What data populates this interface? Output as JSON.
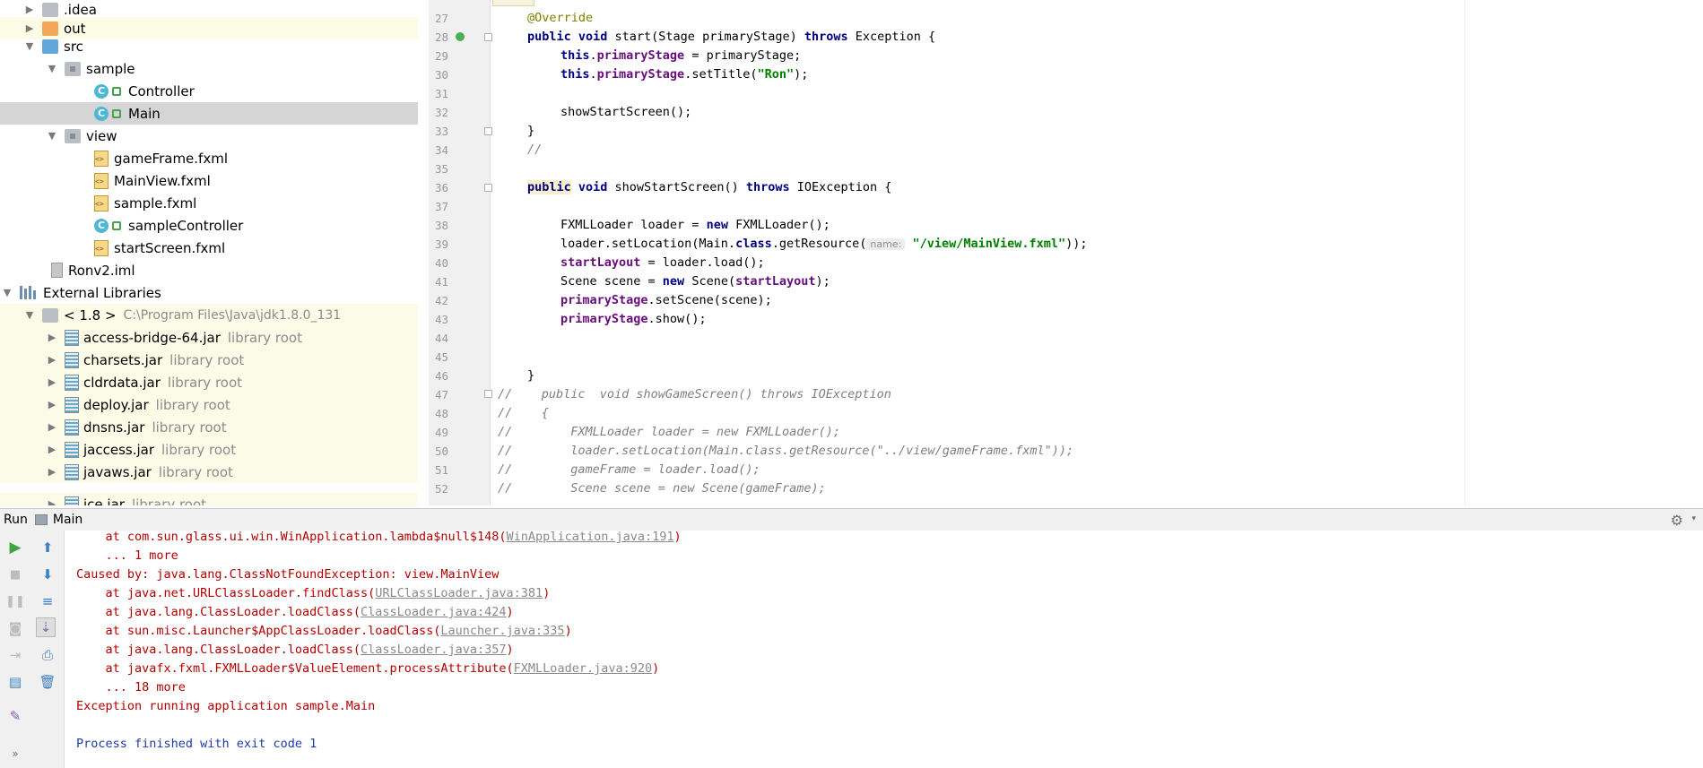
{
  "project_tree": {
    "items": [
      {
        "label": "idea",
        "prefix": ".",
        "arrow": "▶",
        "icon": "folder-icon"
      },
      {
        "label": "out",
        "arrow": "▶",
        "icon": "folder-orange-icon"
      },
      {
        "label": "src",
        "arrow": "▼",
        "icon": "folder-blue-icon"
      },
      {
        "label": "sample",
        "arrow": "▼",
        "icon": "package-icon"
      },
      {
        "label": "Controller",
        "icon": "class-icon"
      },
      {
        "label": "Main",
        "icon": "class-icon"
      },
      {
        "label": "view",
        "arrow": "▼",
        "icon": "package-icon"
      },
      {
        "label": "gameFrame.fxml",
        "icon": "fxml-file-icon"
      },
      {
        "label": "MainView.fxml",
        "icon": "fxml-file-icon"
      },
      {
        "label": "sample.fxml",
        "icon": "fxml-file-icon"
      },
      {
        "label": "sampleController",
        "icon": "class-icon"
      },
      {
        "label": "startScreen.fxml",
        "icon": "fxml-file-icon"
      },
      {
        "label": "Ronv2.iml",
        "icon": "iml-file-icon"
      },
      {
        "label": "External Libraries",
        "arrow": "▼",
        "icon": "libraries-icon"
      },
      {
        "label": "< 1.8 >",
        "detail": "C:\\Program Files\\Java\\jdk1.8.0_131",
        "arrow": "▼",
        "icon": "sdk-folder-icon"
      },
      {
        "label": "access-bridge-64.jar",
        "detail": "library root",
        "arrow": "▶",
        "icon": "jar-icon"
      },
      {
        "label": "charsets.jar",
        "detail": "library root",
        "arrow": "▶",
        "icon": "jar-icon"
      },
      {
        "label": "cldrdata.jar",
        "detail": "library root",
        "arrow": "▶",
        "icon": "jar-icon"
      },
      {
        "label": "deploy.jar",
        "detail": "library root",
        "arrow": "▶",
        "icon": "jar-icon"
      },
      {
        "label": "dnsns.jar",
        "detail": "library root",
        "arrow": "▶",
        "icon": "jar-icon"
      },
      {
        "label": "jaccess.jar",
        "detail": "library root",
        "arrow": "▶",
        "icon": "jar-icon"
      },
      {
        "label": "javaws.jar",
        "detail": "library root",
        "arrow": "▶",
        "icon": "jar-icon"
      },
      {
        "label": "jce.jar",
        "detail": "library root",
        "arrow": "▶",
        "icon": "jar-icon"
      }
    ]
  },
  "editor": {
    "line_numbers": [
      "27",
      "28",
      "29",
      "30",
      "31",
      "32",
      "33",
      "34",
      "35",
      "36",
      "37",
      "38",
      "39",
      "40",
      "41",
      "42",
      "43",
      "44",
      "45",
      "46",
      "47",
      "48",
      "49",
      "50",
      "51",
      "52"
    ],
    "code": {
      "l27": "@Override",
      "l28a": "public void",
      "l28b": " start(Stage primaryStage) ",
      "l28c": "throws",
      "l28d": " Exception {",
      "l29a": "this",
      "l29b": ".",
      "l29c": "primaryStage",
      "l29d": " = primaryStage;",
      "l30a": "this",
      "l30b": ".",
      "l30c": "primaryStage",
      "l30d": ".setTitle(",
      "l30e": "\"Ron\"",
      "l30f": ");",
      "l32": "showStartScreen();",
      "l33": "}",
      "l34": "//",
      "l36a": "public",
      "l36b": " void",
      "l36c": " showStartScreen() ",
      "l36d": "throws",
      "l36e": " IOException {",
      "l38a": "FXMLLoader loader = ",
      "l38b": "new",
      "l38c": " FXMLLoader();",
      "l39a": "loader.setLocation(Main.",
      "l39b": "class",
      "l39c": ".getResource(",
      "l39hint": "name:",
      "l39d": "\"/view/MainView.fxml\"",
      "l39e": "));",
      "l40a": "startLayout",
      "l40b": " = loader.load();",
      "l41a": "Scene scene = ",
      "l41b": "new",
      "l41c": " Scene(",
      "l41d": "startLayout",
      "l41e": ");",
      "l42a": "primaryStage",
      "l42b": ".setScene(scene);",
      "l43a": "primaryStage",
      "l43b": ".show();",
      "l46": "}",
      "l47": "//    public  void showGameScreen() throws IOException",
      "l48": "//    {",
      "l49": "//        FXMLLoader loader = new FXMLLoader();",
      "l50": "//        loader.setLocation(Main.class.getResource(\"../view/gameFrame.fxml\"));",
      "l51": "//        gameFrame = loader.load();",
      "l52": "//        Scene scene = new Scene(gameFrame);"
    }
  },
  "run_panel": {
    "title": "Run",
    "config": "Main",
    "console": [
      {
        "pre": "    at com.sun.glass.ui.win.WinApplication.lambda$null$148(",
        "link": "WinApplication.java:191",
        "post": ")"
      },
      {
        "pre": "    ... 1 more"
      },
      {
        "pre": "Caused by: java.lang.ClassNotFoundException: view.MainView"
      },
      {
        "pre": "    at java.net.URLClassLoader.findClass(",
        "link": "URLClassLoader.java:381",
        "post": ")"
      },
      {
        "pre": "    at java.lang.ClassLoader.loadClass(",
        "link": "ClassLoader.java:424",
        "post": ")"
      },
      {
        "pre": "    at sun.misc.Launcher$AppClassLoader.loadClass(",
        "link": "Launcher.java:335",
        "post": ")"
      },
      {
        "pre": "    at java.lang.ClassLoader.loadClass(",
        "link": "ClassLoader.java:357",
        "post": ")"
      },
      {
        "pre": "    at javafx.fxml.FXMLLoader$ValueElement.processAttribute(",
        "link": "FXMLLoader.java:920",
        "post": ")"
      },
      {
        "pre": "    ... 18 more"
      },
      {
        "pre": "Exception running application sample.Main"
      },
      {
        "pre": ""
      },
      {
        "pre": "Process finished with exit code 1"
      }
    ],
    "toolbar_icons": [
      "run-icon",
      "up-arrow-icon",
      "stop-icon",
      "down-arrow-icon",
      "pause-icon",
      "soft-wrap-icon",
      "camera-icon",
      "scroll-to-end-icon",
      "exit-icon",
      "print-icon",
      "layout-icon",
      "trash-icon",
      "pin-icon",
      "more-icon"
    ]
  },
  "colors": {
    "keyword": "#000080",
    "string": "#008000",
    "field": "#660e7a",
    "comment": "#808080",
    "error": "#b20000",
    "info": "#1f3ca6",
    "selection": "#d5d5d5",
    "library_bg": "#fbfbe8"
  }
}
